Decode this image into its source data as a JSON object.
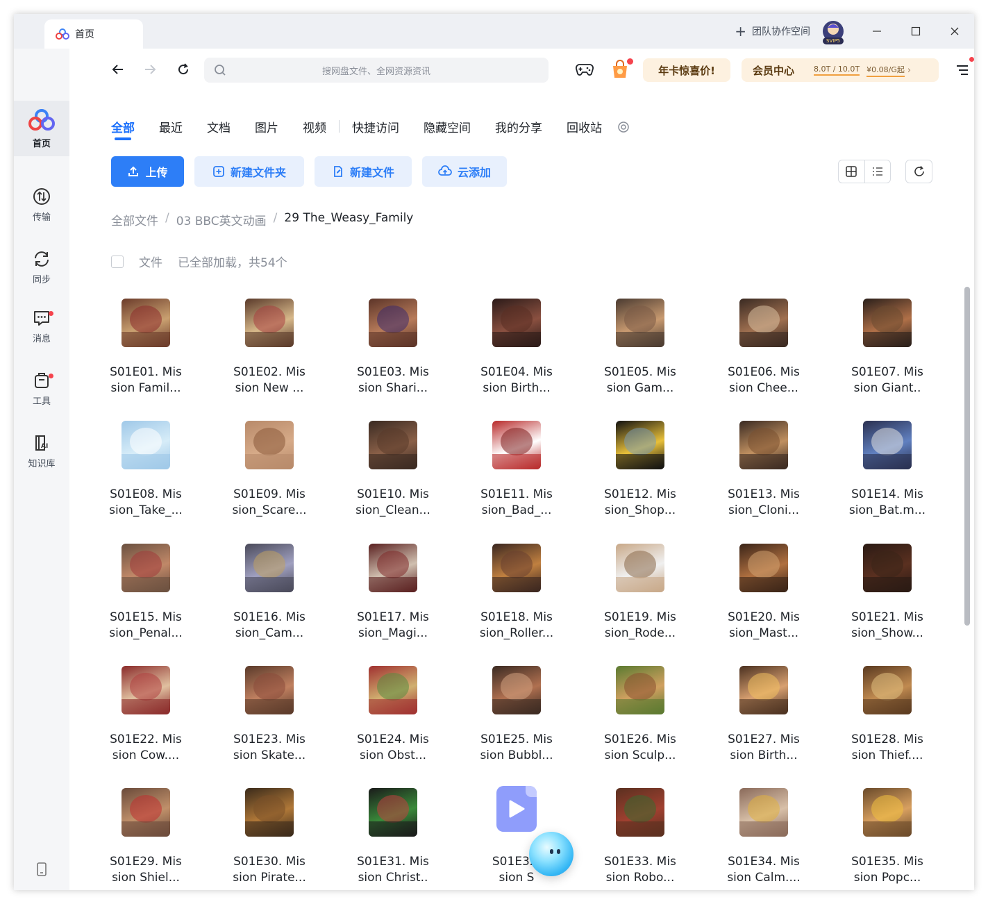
{
  "window": {
    "tab_title": "首页",
    "team_space": "团队协作空间",
    "avatar_badge": "SVIP5"
  },
  "sidebar": {
    "items": [
      {
        "label": "首页",
        "icon": "home-logo-icon",
        "active": true
      },
      {
        "label": "传输",
        "icon": "transfer-icon"
      },
      {
        "label": "同步",
        "icon": "sync-icon"
      },
      {
        "label": "消息",
        "icon": "message-icon",
        "dot": true
      },
      {
        "label": "工具",
        "icon": "toolbox-icon",
        "dot": true
      },
      {
        "label": "知识库",
        "icon": "knowledge-ai-icon"
      }
    ]
  },
  "toolbar": {
    "search_placeholder": "搜网盘文件、全网资源资讯",
    "promo_label": "年卡惊喜价!",
    "vip_label": "会员中心",
    "vip_storage": "8.0T / 10.0T",
    "vip_price": "¥0.08/G起",
    "vip_chevron": "›"
  },
  "categories": [
    "全部",
    "最近",
    "文档",
    "图片",
    "视频",
    "快捷访问",
    "隐藏空间",
    "我的分享",
    "回收站"
  ],
  "actions": {
    "upload": "上传",
    "new_folder": "新建文件夹",
    "new_file": "新建文件",
    "cloud_add": "云添加"
  },
  "breadcrumb": {
    "root": "全部文件",
    "level1": "03 BBC英文动画",
    "sep": "/",
    "current": "29 The_Weasy_Family"
  },
  "list_header": {
    "type_label": "文件",
    "count_text": "已全部加载，共54个"
  },
  "files": [
    {
      "l1": "S01E01. Mis",
      "l2": "sion Famil..."
    },
    {
      "l1": "S01E02. Mis",
      "l2": "sion New ..."
    },
    {
      "l1": "S01E03. Mis",
      "l2": "sion Shari..."
    },
    {
      "l1": "S01E04. Mis",
      "l2": "sion Birth..."
    },
    {
      "l1": "S01E05. Mis",
      "l2": "sion Gam..."
    },
    {
      "l1": "S01E06. Mis",
      "l2": "sion Chee..."
    },
    {
      "l1": "S01E07. Mis",
      "l2": "sion Giant.."
    },
    {
      "l1": "S01E08. Mis",
      "l2": "sion_Take_..."
    },
    {
      "l1": "S01E09. Mis",
      "l2": "sion_Scare..."
    },
    {
      "l1": "S01E10. Mis",
      "l2": "sion_Clean..."
    },
    {
      "l1": "S01E11. Mis",
      "l2": "sion_Bad_..."
    },
    {
      "l1": "S01E12. Mis",
      "l2": "sion_Shop..."
    },
    {
      "l1": "S01E13. Mis",
      "l2": "sion_Cloni..."
    },
    {
      "l1": "S01E14. Mis",
      "l2": "sion_Bat.m..."
    },
    {
      "l1": "S01E15. Mis",
      "l2": "sion_Penal..."
    },
    {
      "l1": "S01E16. Mis",
      "l2": "sion_Cam..."
    },
    {
      "l1": "S01E17. Mis",
      "l2": "sion_Magi..."
    },
    {
      "l1": "S01E18. Mis",
      "l2": "sion_Roller..."
    },
    {
      "l1": "S01E19. Mis",
      "l2": "sion_Rode..."
    },
    {
      "l1": "S01E20. Mis",
      "l2": "sion_Mast..."
    },
    {
      "l1": "S01E21. Mis",
      "l2": "sion_Show..."
    },
    {
      "l1": "S01E22. Mis",
      "l2": "sion Cow...."
    },
    {
      "l1": "S01E23. Mis",
      "l2": "sion Skate..."
    },
    {
      "l1": "S01E24. Mis",
      "l2": "sion Obst..."
    },
    {
      "l1": "S01E25. Mis",
      "l2": "sion Bubbl..."
    },
    {
      "l1": "S01E26. Mis",
      "l2": "sion Sculp..."
    },
    {
      "l1": "S01E27. Mis",
      "l2": "sion Birth..."
    },
    {
      "l1": "S01E28. Mis",
      "l2": "sion Thief...."
    },
    {
      "l1": "S01E29. Mis",
      "l2": "sion Shiel..."
    },
    {
      "l1": "S01E30. Mis",
      "l2": "sion Pirate..."
    },
    {
      "l1": "S01E31. Mis",
      "l2": "sion Christ.."
    },
    {
      "l1": "S01E32.",
      "l2": "sion S"
    },
    {
      "l1": "S01E33. Mis",
      "l2": "sion Robo..."
    },
    {
      "l1": "S01E34. Mis",
      "l2": "sion Calm...."
    },
    {
      "l1": "S01E35. Mis",
      "l2": "sion Popc..."
    }
  ],
  "colors": {
    "accent": "#1b70fb",
    "primary_button": "#2d7ef7",
    "light_button": "#e8f0fd",
    "notification_dot": "#f5434d",
    "video_icon": "#8f9dfb"
  }
}
